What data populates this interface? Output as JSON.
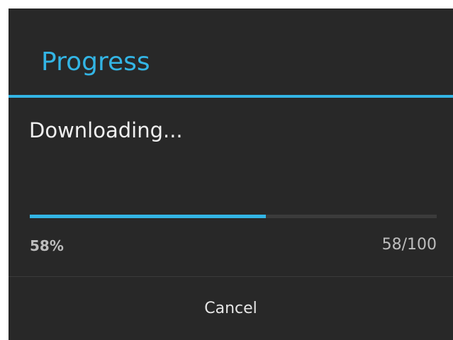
{
  "dialog": {
    "title": "Progress",
    "message": "Downloading...",
    "progress": {
      "fraction": 0.58,
      "percent_label": "58%",
      "count_label": "58/100"
    },
    "cancel_label": "Cancel"
  },
  "colors": {
    "accent": "#33b5e5",
    "background": "#282828",
    "track": "#3b3b3b"
  }
}
